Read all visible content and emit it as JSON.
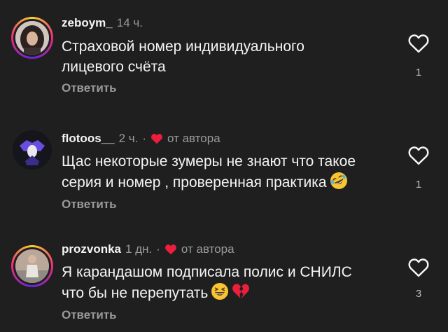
{
  "comments": [
    {
      "username": "zeboym_",
      "time": "14 ч.",
      "text_lines": [
        "Страховой номер индивидуального",
        "лицевого счёта"
      ],
      "reply_label": "Ответить",
      "like_count": "1"
    },
    {
      "username": "flotoos__",
      "time": "2 ч.",
      "dot": "·",
      "author_label": "от автора",
      "text_lines": [
        "Щас некоторые зумеры не знают что такое",
        "серия и номер , проверенная практика"
      ],
      "emoji": "rolling-on-floor-laughing",
      "reply_label": "Ответить",
      "like_count": "1"
    },
    {
      "username": "prozvonka",
      "time": "1 дн.",
      "dot": "·",
      "author_label": "от автора",
      "text_lines": [
        "Я карандашом подписала полис и СНИЛС",
        "что бы не перепутать"
      ],
      "emoji": [
        "laughing-face",
        "broken-heart"
      ],
      "reply_label": "Ответить",
      "like_count": "3"
    }
  ],
  "colors": {
    "background": "#1f1f1f",
    "secondary_text": "#9a9a9a",
    "author_heart": "#ed1d3d"
  }
}
